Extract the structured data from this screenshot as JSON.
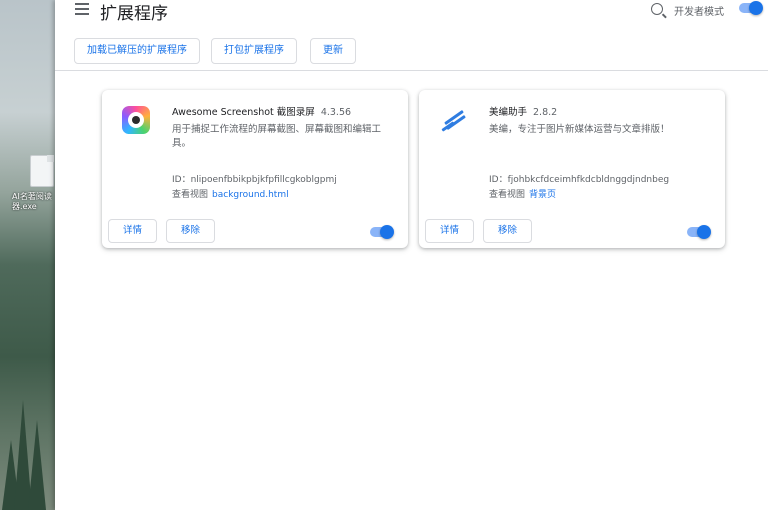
{
  "header": {
    "title": "扩展程序",
    "developer_mode_label": "开发者模式",
    "developer_mode_on": true
  },
  "toolbar": {
    "load_unpacked": "加载已解压的扩展程序",
    "pack": "打包扩展程序",
    "update": "更新"
  },
  "desktop": {
    "file_label": "AI名著阅读器.exe"
  },
  "extensions": [
    {
      "name": "Awesome Screenshot 截图录屏",
      "version": "4.3.56",
      "description": "用于捕捉工作流程的屏幕截图、屏幕截图和编辑工具。",
      "id_text": "ID：nlipoenfbbikpbjkfpfillcgkoblgpmj",
      "views_label": "查看视图",
      "views_link": "background.html",
      "details_label": "详情",
      "remove_label": "移除",
      "enabled": true,
      "icon": "screenshot-camera-icon"
    },
    {
      "name": "美编助手",
      "version": "2.8.2",
      "description": "美编，专注于图片新媒体运营与文章排版！",
      "id_text": "ID：fjohbkcfdceimhfkdcbldnggdjndnbeg",
      "views_label": "查看视图",
      "views_link": "背景页",
      "details_label": "详情",
      "remove_label": "移除",
      "enabled": true,
      "icon": "editor-pen-icon"
    }
  ],
  "colors": {
    "accent": "#1a73e8",
    "toggle_track": "#8ab4f8"
  }
}
